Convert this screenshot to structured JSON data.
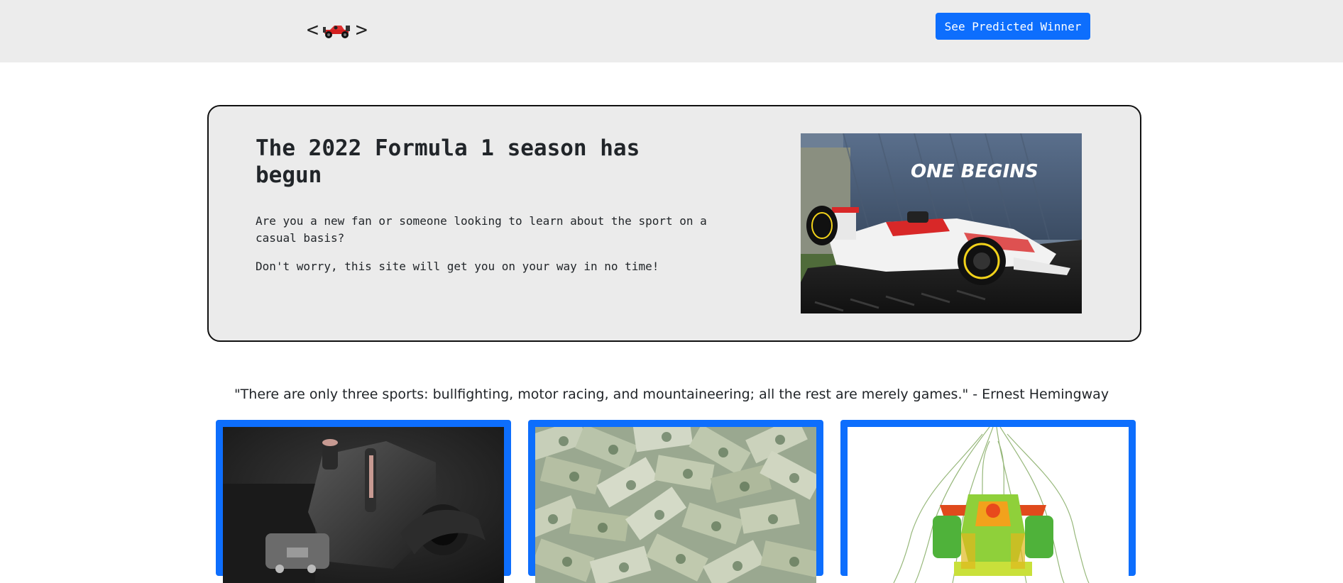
{
  "navbar": {
    "brand_left": "<",
    "brand_right": ">",
    "brand_icon": "race-car-icon",
    "predict_button_label": "See Predicted Winner",
    "accent_color": "#0d6efd"
  },
  "hero": {
    "title": "The 2022 Formula 1 season has begun",
    "paragraph_1": "Are you a new fan or someone looking to learn about the sport on a casual basis?",
    "paragraph_2": "Don't worry, this site will get you on your way in no time!",
    "image_banner_text": "ONE BEGINS"
  },
  "quote": {
    "text": "\"There are only three sports: bullfighting, motor racing, and mountaineering; all the rest are merely games.\" - Ernest Hemingway"
  },
  "cards": [
    {
      "image": "engine-image"
    },
    {
      "image": "money-image"
    },
    {
      "image": "aerodynamics-image"
    }
  ]
}
